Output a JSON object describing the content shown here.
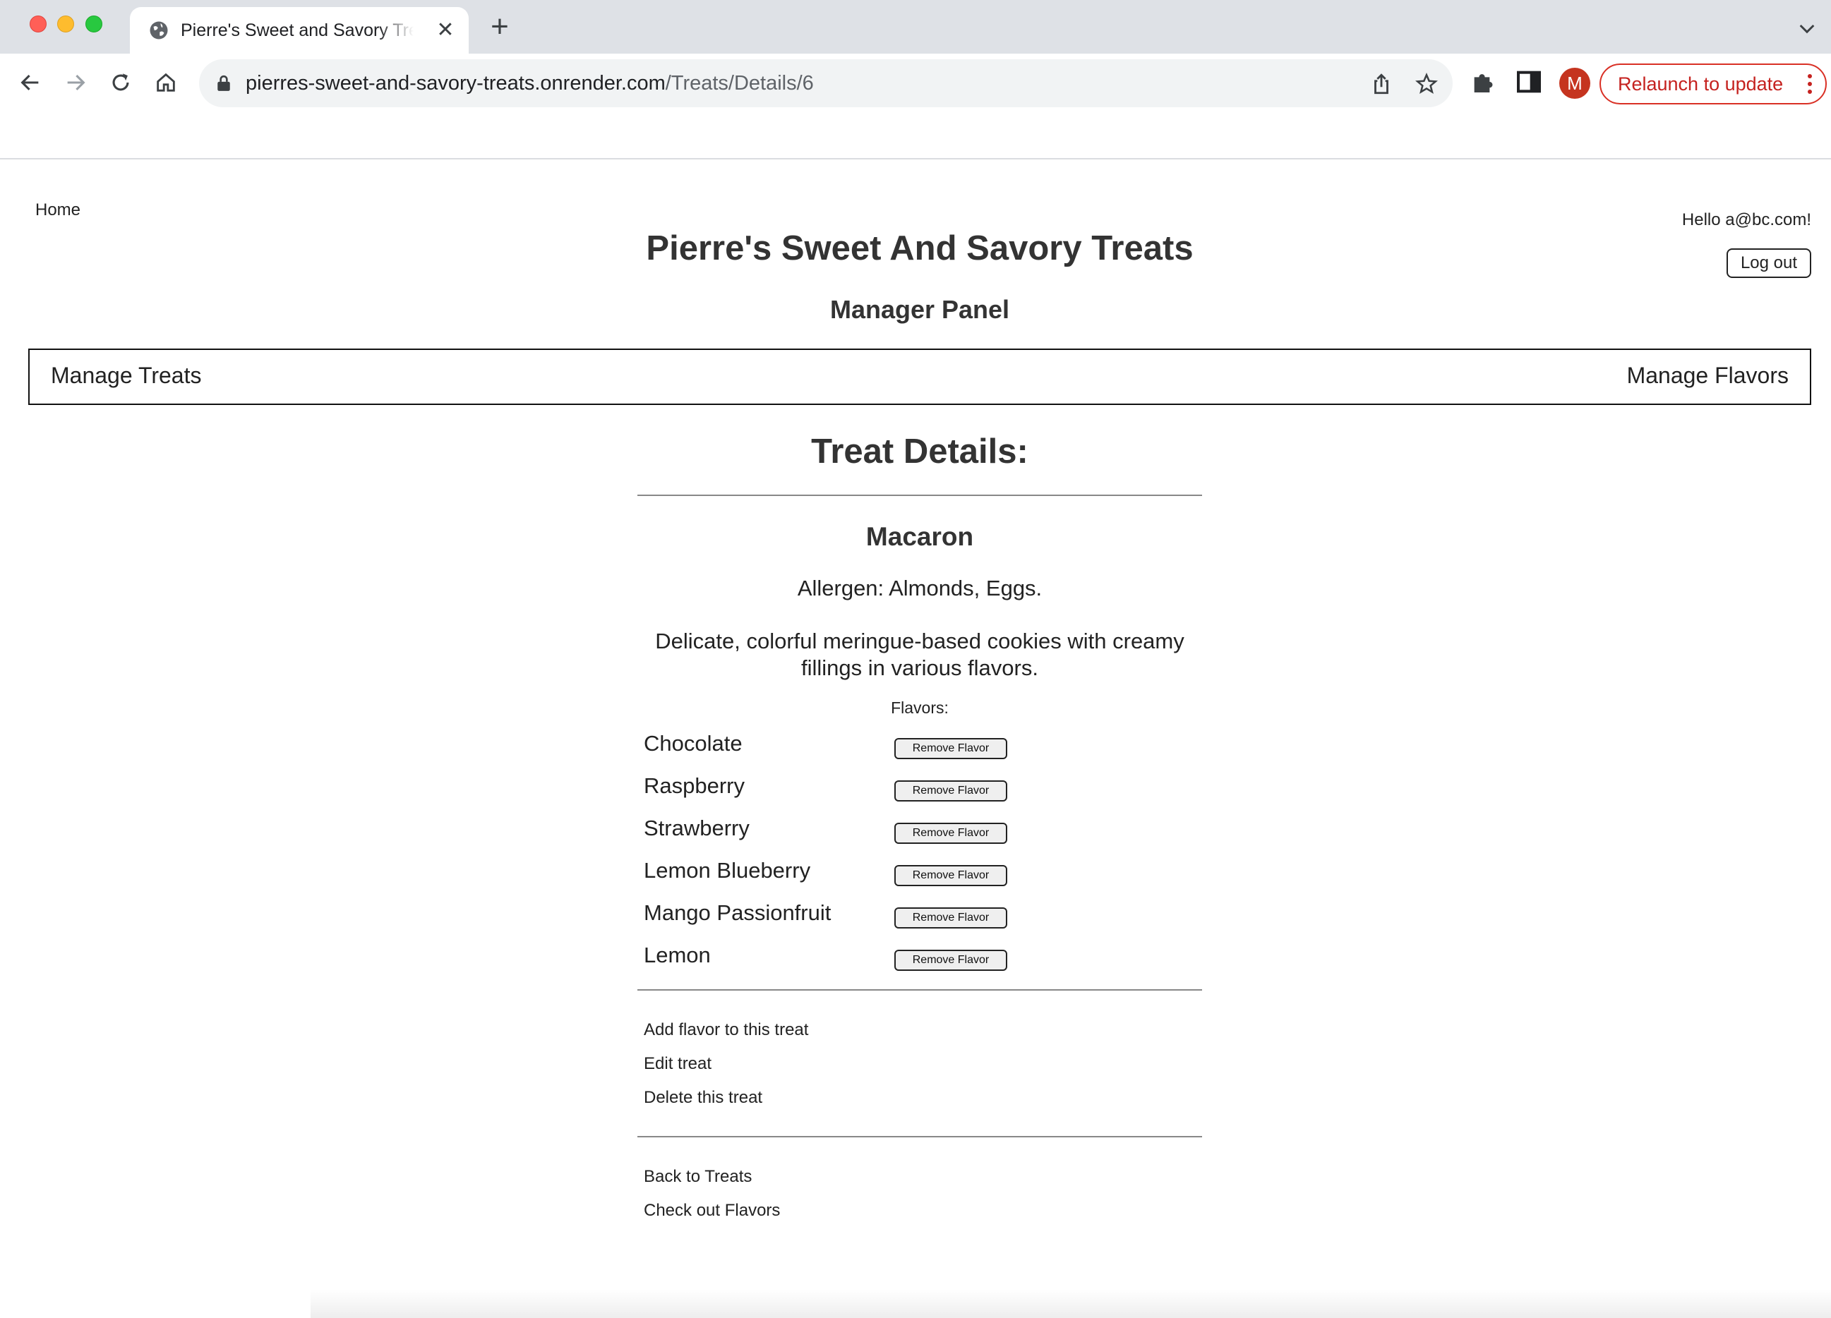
{
  "browser": {
    "tab_title": "Pierre's Sweet and Savory Treats",
    "url_host": "pierres-sweet-and-savory-treats.onrender.com",
    "url_path": "/Treats/Details/6",
    "avatar_letter": "M",
    "relaunch_label": "Relaunch to update"
  },
  "header": {
    "home_link": "Home",
    "greeting": "Hello a@bc.com!",
    "logout_label": "Log out",
    "site_title": "Pierre's Sweet And Savory Treats",
    "panel_title": "Manager Panel"
  },
  "manager_nav": {
    "manage_treats": "Manage Treats",
    "manage_flavors": "Manage Flavors"
  },
  "details": {
    "heading": "Treat Details:",
    "treat_name": "Macaron",
    "allergen": "Allergen: Almonds, Eggs.",
    "description": "Delicate, colorful meringue-based cookies with creamy fillings in various flavors.",
    "flavors_label": "Flavors:",
    "remove_label": "Remove Flavor",
    "flavors": [
      "Chocolate",
      "Raspberry",
      "Strawberry",
      "Lemon Blueberry",
      "Mango Passionfruit",
      "Lemon"
    ]
  },
  "actions": {
    "add_flavor": "Add flavor to this treat",
    "edit_treat": "Edit treat",
    "delete_treat": "Delete this treat",
    "back_to_treats": "Back to Treats",
    "check_flavors": "Check out Flavors"
  },
  "colors": {
    "tabstrip": "#dee1e6",
    "relaunch": "#d93025",
    "avatar": "#c5341f"
  }
}
